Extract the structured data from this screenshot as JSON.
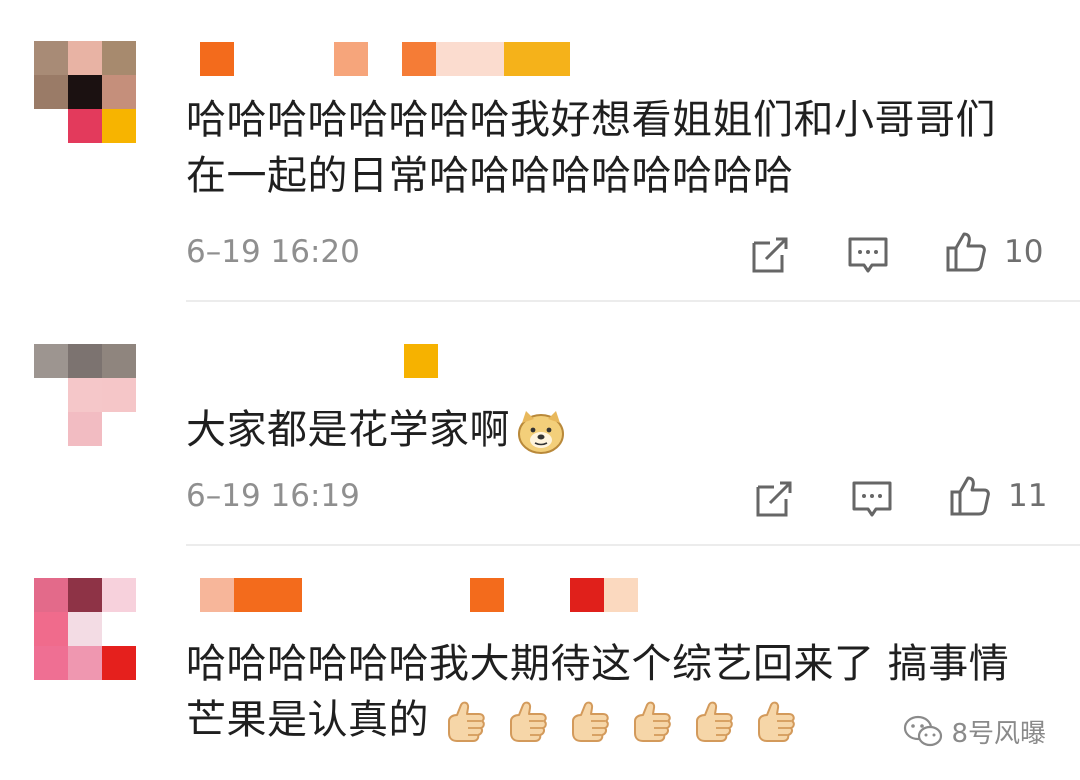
{
  "comments": [
    {
      "text": "哈哈哈哈哈哈哈哈我好想看姐姐们和小哥哥们在一起的日常哈哈哈哈哈哈哈哈哈",
      "time": "6–19 16:20",
      "likes": "10",
      "emoji": []
    },
    {
      "text": "大家都是花学家啊",
      "time": "6–19 16:19",
      "likes": "11",
      "emoji": [
        "doge-emoji"
      ]
    },
    {
      "text": "哈哈哈哈哈哈我大期待这个综艺回来了 搞事情芒果是认真的",
      "emoji": [
        "thumbs-up-emoji",
        "thumbs-up-emoji",
        "thumbs-up-emoji",
        "thumbs-up-emoji",
        "thumbs-up-emoji",
        "thumbs-up-emoji"
      ]
    }
  ],
  "watermark": {
    "text": "8号风曝",
    "icon": "wechat-icon"
  },
  "icons": {
    "share": "share-icon",
    "reply": "comment-icon",
    "like": "thumbs-up-icon"
  },
  "colors": {
    "text": "#1f1f1f",
    "meta": "#8f8f8f",
    "divider": "#ececec",
    "background": "#ffffff"
  }
}
